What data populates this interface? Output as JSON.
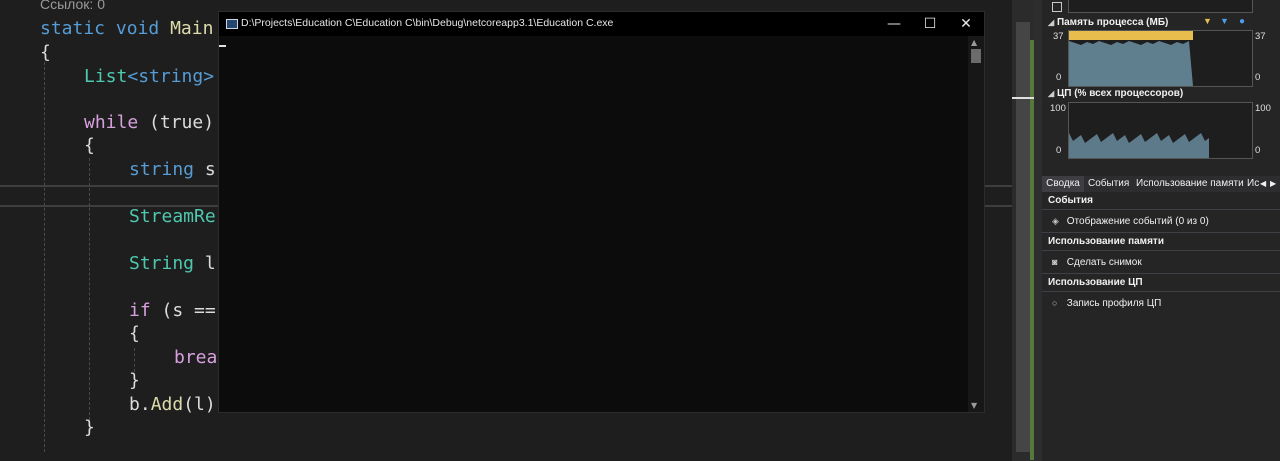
{
  "editor": {
    "ref_count": "Ссылок: 0",
    "lines": {
      "l1_kw": "static",
      "l1_kw2": "void",
      "l1_fn": "Main",
      "l2": "{",
      "l3_type": "List",
      "l3_rest": "<string>",
      "l4_kw": "while",
      "l4_rest": " (true)",
      "l5": "{",
      "l6_kw": "string",
      "l6_rest": " s",
      "l7_type": "StreamRe",
      "l8_type": "String",
      "l8_rest": " l",
      "l9_kw": "if",
      "l9_rest": " (s ==",
      "l10": "{",
      "l11_kw": "brea",
      "l12": "}",
      "l13_pre": "b.",
      "l13_fn": "Add",
      "l13_rest": "(l)",
      "l14": "}"
    }
  },
  "console": {
    "title": "D:\\Projects\\Education C\\Education C\\bin\\Debug\\netcoreapp3.1\\Education C.exe",
    "minimize": "—",
    "maximize": "☐",
    "close": "✕"
  },
  "diagnostics": {
    "memory": {
      "title": "Память процесса (МБ)",
      "max": "37",
      "min": "0",
      "fill_fraction": 0.68
    },
    "cpu": {
      "title": "ЦП (% всех процессоров)",
      "max": "100",
      "min": "0"
    },
    "tabs": [
      "Сводка",
      "События",
      "Использование памяти",
      "Ис"
    ],
    "events_header": "События",
    "events_item": "Отображение событий (0 из 0)",
    "memory_header": "Использование памяти",
    "memory_item": "Сделать снимок",
    "cpu_header": "Использование ЦП",
    "cpu_item": "Запись профиля ЦП",
    "colors": {
      "memory_area": "#5f7f8e",
      "memory_highlight": "#e8bd4d",
      "cpu_area": "#5c7a8a",
      "snapshot_marker": "#4d9ce8"
    }
  }
}
